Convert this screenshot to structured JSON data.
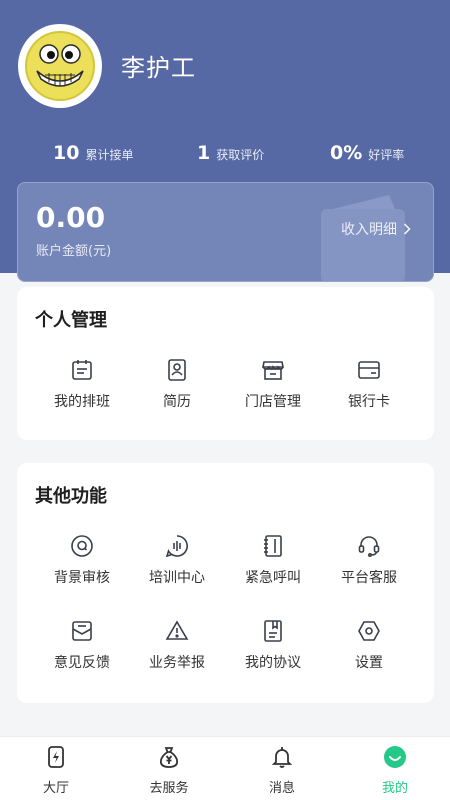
{
  "profile": {
    "name": "李护工"
  },
  "stats": [
    {
      "value": "10",
      "label": "累计接单"
    },
    {
      "value": "1",
      "label": "获取评价"
    },
    {
      "value": "0%",
      "label": "好评率"
    }
  ],
  "balance": {
    "amount": "0.00",
    "label": "账户金额(元)",
    "detail_link": "收入明细"
  },
  "personal": {
    "title": "个人管理",
    "items": [
      {
        "label": "我的排班",
        "icon": "calendar-icon"
      },
      {
        "label": "简历",
        "icon": "id-card-icon"
      },
      {
        "label": "门店管理",
        "icon": "store-icon"
      },
      {
        "label": "银行卡",
        "icon": "bank-card-icon"
      }
    ]
  },
  "other": {
    "title": "其他功能",
    "items": [
      {
        "label": "背景审核",
        "icon": "search-badge-icon"
      },
      {
        "label": "培训中心",
        "icon": "audio-wave-icon"
      },
      {
        "label": "紧急呼叫",
        "icon": "notebook-icon"
      },
      {
        "label": "平台客服",
        "icon": "headset-icon"
      },
      {
        "label": "意见反馈",
        "icon": "envelope-icon"
      },
      {
        "label": "业务举报",
        "icon": "warning-icon"
      },
      {
        "label": "我的协议",
        "icon": "document-icon"
      },
      {
        "label": "设置",
        "icon": "settings-icon"
      }
    ]
  },
  "tabs": [
    {
      "label": "大厅",
      "icon": "lightning-phone-icon"
    },
    {
      "label": "去服务",
      "icon": "money-bag-icon"
    },
    {
      "label": "消息",
      "icon": "bell-icon"
    },
    {
      "label": "我的",
      "icon": "smile-icon",
      "active": true
    }
  ],
  "colors": {
    "header": "#5669a4",
    "accent": "#24c98a",
    "icon_stroke": "#3a3f4b"
  }
}
